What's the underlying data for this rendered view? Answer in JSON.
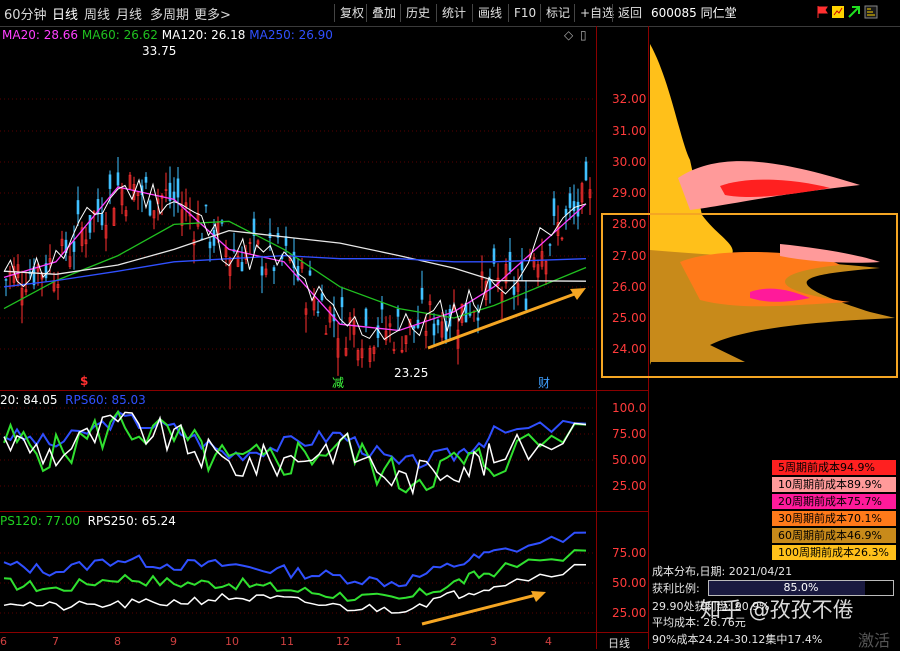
{
  "toolbar": {
    "tabs": [
      "60分钟",
      "日线",
      "周线",
      "月线",
      "多周期",
      "更多>"
    ],
    "buttons": [
      "复权",
      "叠加",
      "历史",
      "统计",
      "画线",
      "F10",
      "标记",
      "+自选",
      "返回"
    ],
    "stock": "600085 同仁堂"
  },
  "main_chart": {
    "legend": [
      {
        "label": "MA20: 28.66",
        "color": "#ff40ff"
      },
      {
        "label": "MA60: 26.62",
        "color": "#20c020"
      },
      {
        "label": "MA120: 26.18",
        "color": "#ffffff"
      },
      {
        "label": "MA250: 26.90",
        "color": "#3050ff"
      }
    ],
    "high_label": "33.75",
    "low_label": "23.25",
    "markers": [
      "$",
      "减",
      "财"
    ],
    "y_ticks": [
      "32.00",
      "31.00",
      "30.00",
      "29.00",
      "28.00",
      "27.00",
      "26.00",
      "25.00",
      "24.00"
    ]
  },
  "rps_panel_1": {
    "legend": [
      {
        "label": "20: 84.05",
        "color": "#ffffff"
      },
      {
        "label": "RPS60: 85.03",
        "color": "#3050ff"
      }
    ],
    "y_ticks": [
      "100.0",
      "75.00",
      "50.00",
      "25.00"
    ]
  },
  "rps_panel_2": {
    "legend": [
      {
        "label": "PS120: 77.00",
        "color": "#20d020"
      },
      {
        "label": "RPS250: 65.24",
        "color": "#ffffff"
      }
    ],
    "y_ticks": [
      "75.00",
      "50.00",
      "25.00"
    ]
  },
  "x_axis": [
    "6",
    "7",
    "8",
    "9",
    "10",
    "11",
    "12",
    "1",
    "2",
    "3",
    "4"
  ],
  "x_axis_unit": "日线",
  "cost_distribution": {
    "legend": [
      {
        "label": "5周期前成本94.9%",
        "color": "#ff2020"
      },
      {
        "label": "10周期前成本89.9%",
        "color": "#ff9a9a"
      },
      {
        "label": "20周期前成本75.7%",
        "color": "#ff1a9a"
      },
      {
        "label": "30周期前成本70.1%",
        "color": "#ff7a1a"
      },
      {
        "label": "60周期前成本46.9%",
        "color": "#c88a1a"
      },
      {
        "label": "100周期前成本26.3%",
        "color": "#ffc01a"
      }
    ],
    "date_line": "成本分布,日期: 2021/04/21",
    "profit_label": "获利比例:",
    "profit_value": "85.0%",
    "range_line": "29.90处获利盘: 90.9%",
    "avg_cost": "平均成本: 26.76元",
    "concentration": "90%成本24.24-30.12集中17.4%",
    "watermark": "知乎 @孜孜不倦",
    "activate": "激活"
  },
  "chart_data": {
    "type": "line",
    "title": "600085 同仁堂",
    "x": [
      "6",
      "7",
      "8",
      "9",
      "10",
      "11",
      "12",
      "1",
      "2",
      "3",
      "4"
    ],
    "ylim": [
      23.5,
      32.5
    ],
    "series": [
      {
        "name": "MA20",
        "values": [
          26.3,
          26.8,
          29.2,
          28.8,
          27.2,
          26.8,
          24.8,
          24.6,
          25.2,
          26.0,
          28.66
        ]
      },
      {
        "name": "MA60",
        "values": [
          25.3,
          26.2,
          27.0,
          28.0,
          28.1,
          27.2,
          26.0,
          25.3,
          25.0,
          25.4,
          26.62
        ]
      },
      {
        "name": "MA120",
        "values": [
          26.5,
          26.4,
          26.7,
          27.2,
          27.8,
          27.6,
          27.4,
          27.0,
          26.6,
          26.2,
          26.18
        ]
      },
      {
        "name": "MA250",
        "values": [
          26.0,
          26.2,
          26.5,
          26.8,
          26.9,
          27.0,
          26.9,
          26.9,
          26.8,
          26.8,
          26.9
        ]
      },
      {
        "name": "RPS20",
        "values": [
          70,
          55,
          85,
          70,
          45,
          50,
          65,
          30,
          45,
          50,
          84.05
        ]
      },
      {
        "name": "RPS60",
        "values": [
          75,
          65,
          90,
          80,
          55,
          65,
          75,
          45,
          55,
          75,
          85.03
        ]
      },
      {
        "name": "RPS120",
        "values": [
          50,
          45,
          55,
          50,
          50,
          45,
          40,
          35,
          50,
          60,
          77.0
        ]
      },
      {
        "name": "RPS250",
        "values": [
          35,
          30,
          32,
          34,
          38,
          36,
          30,
          28,
          40,
          48,
          65.24
        ]
      }
    ],
    "annotations": [
      "33.75",
      "23.25"
    ]
  }
}
